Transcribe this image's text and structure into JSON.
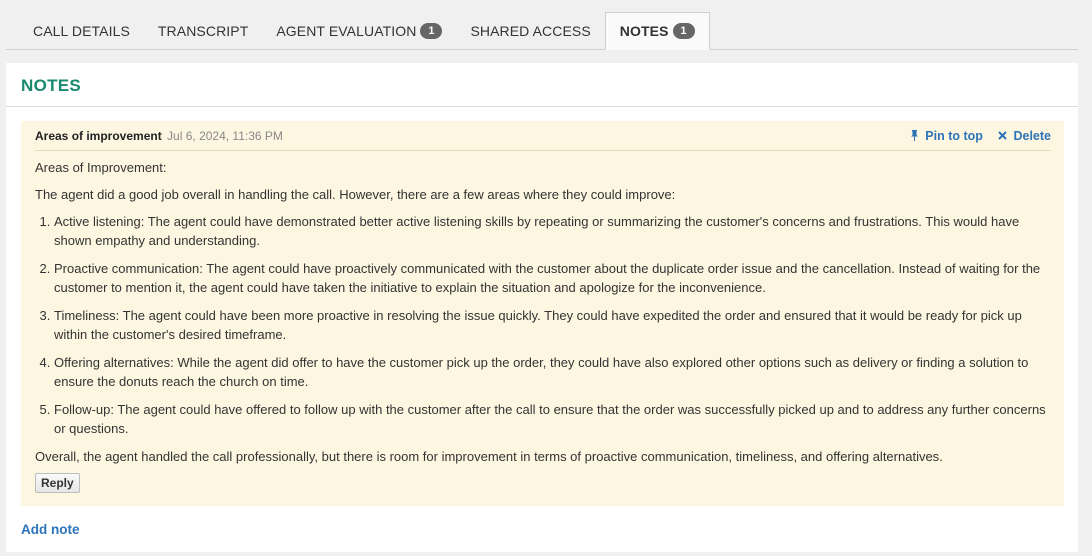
{
  "tabs": [
    {
      "label": "CALL DETAILS",
      "badge": null
    },
    {
      "label": "TRANSCRIPT",
      "badge": null
    },
    {
      "label": "AGENT EVALUATION",
      "badge": "1"
    },
    {
      "label": "SHARED ACCESS",
      "badge": null
    },
    {
      "label": "NOTES",
      "badge": "1",
      "active": true
    }
  ],
  "panel": {
    "title": "NOTES"
  },
  "note": {
    "author": "Areas of improvement",
    "date": "Jul 6, 2024, 11:36 PM",
    "pin_label": "Pin to top",
    "delete_label": "Delete",
    "body_heading": "Areas of Improvement:",
    "intro": "The agent did a good job overall in handling the call. However, there are a few areas where they could improve:",
    "items": [
      "Active listening: The agent could have demonstrated better active listening skills by repeating or summarizing the customer's concerns and frustrations. This would have shown empathy and understanding.",
      "Proactive communication: The agent could have proactively communicated with the customer about the duplicate order issue and the cancellation. Instead of waiting for the customer to mention it, the agent could have taken the initiative to explain the situation and apologize for the inconvenience.",
      "Timeliness: The agent could have been more proactive in resolving the issue quickly. They could have expedited the order and ensured that it would be ready for pick up within the customer's desired timeframe.",
      "Offering alternatives: While the agent did offer to have the customer pick up the order, they could have also explored other options such as delivery or finding a solution to ensure the donuts reach the church on time.",
      "Follow-up: The agent could have offered to follow up with the customer after the call to ensure that the order was successfully picked up and to address any further concerns or questions."
    ],
    "conclusion": "Overall, the agent handled the call professionally, but there is room for improvement in terms of proactive communication, timeliness, and offering alternatives.",
    "reply_label": "Reply"
  },
  "add_note_label": "Add note",
  "icons": {
    "pin": "pin-icon",
    "delete": "close-icon"
  },
  "colors": {
    "title_green": "#19896f",
    "link_blue": "#2d74b8",
    "note_bg": "#fdf7e1",
    "badge_bg": "#666666"
  }
}
